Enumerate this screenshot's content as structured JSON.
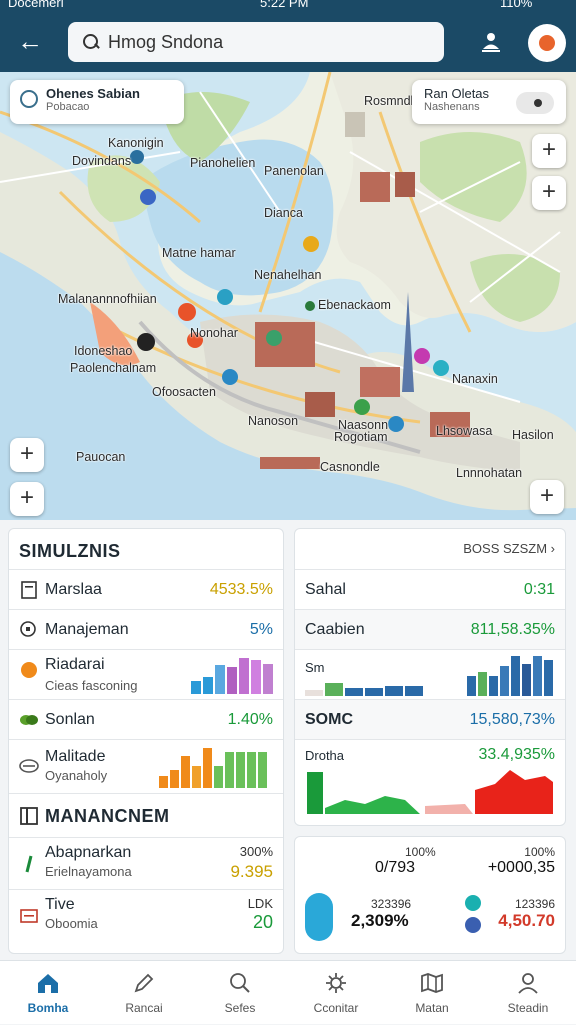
{
  "status_bar": {
    "carrier": "Docemeri",
    "time": "5:22 PM",
    "battery": "110%"
  },
  "search": {
    "value": "Hmog Sndona"
  },
  "map": {
    "left_card": {
      "title": "Ohenes Sabian",
      "subtitle": "Pobacao"
    },
    "right_card": {
      "title": "Ran Oletas",
      "subtitle": "Nashenans"
    },
    "labels": [
      "Rosmndle",
      "Kanonigin",
      "Dovindans",
      "Pianohelien",
      "Panenolan",
      "Dianca",
      "Matne hamar",
      "Nenahelhan",
      "Malanannnofhiian",
      "Ebenackaom",
      "Idoneshao",
      "Paolenchalnam",
      "Ofoosacten",
      "Nanaxin",
      "Naasonn",
      "Rogotiam",
      "Nanoson",
      "Casnondle",
      "Lnnnohatan",
      "Pauocan",
      "Hasilon",
      "Lhsowasa",
      "Nonohar"
    ]
  },
  "left_panel": {
    "header": "SIMULZNIS",
    "rows": [
      {
        "label": "Marslaa",
        "value": "4533.5%",
        "color": "#c9a000"
      },
      {
        "label": "Manajeman",
        "value": "5%",
        "color": "#1b6ea8"
      },
      {
        "label": "Riadarai",
        "sub": "Cieas fasconing"
      },
      {
        "label": "Sonlan",
        "value": "1.40%",
        "color": "#1a9a3a"
      },
      {
        "label": "Malitade",
        "sub": "Oyanaholy"
      }
    ],
    "section": "MANANCNEM",
    "rows2": [
      {
        "label": "Abapnarkan",
        "sub": "Erielnayamona",
        "value_top": "300%",
        "value": "9.395",
        "color": "#c9a000"
      },
      {
        "label": "Tive",
        "sub": "Oboomia",
        "value_top": "LDK",
        "value": "20",
        "color": "#1a9a3a"
      }
    ]
  },
  "right_panel": {
    "header": "BOSS SZSZM",
    "rows": [
      {
        "label": "Sahal",
        "value": "0:31",
        "color": "#1a9a3a"
      },
      {
        "label": "Caabien",
        "value": "811,58.35%",
        "color": "#1a9a3a"
      },
      {
        "label": "Sm"
      },
      {
        "label": "SOMC",
        "value": "15,580,73%",
        "color": "#1b6ea8"
      },
      {
        "label": "Drotha",
        "value": "33.4,935%",
        "color": "#1a9a3a"
      }
    ],
    "stats": [
      {
        "top": "100%",
        "value": "0/793"
      },
      {
        "top": "100%",
        "value": "+0000,35"
      },
      {
        "top": "323396",
        "value": "2,309%"
      },
      {
        "top": "123396",
        "value": "4,50.70",
        "color": "#d23a2a"
      }
    ]
  },
  "charts": {
    "riadarai": [
      0.35,
      0.45,
      0.75,
      0.7,
      0.95,
      0.9,
      0.8
    ],
    "malitade": [
      0.3,
      0.45,
      0.8,
      0.55,
      1.0,
      0.55,
      0.9,
      0.9,
      0.9,
      0.9
    ],
    "sm_left": [
      0.15,
      0.35,
      0.2,
      0.2,
      0.25,
      0.25
    ],
    "sm_right": [
      0.5,
      0.6,
      0.5,
      0.75,
      1.0,
      0.8,
      1.0,
      0.9
    ],
    "drotha_colors": [
      "#1a9a3a",
      "#2db34a",
      "#e8231a"
    ]
  },
  "nav": [
    {
      "label": "Bomha",
      "icon": "home-icon",
      "active": true
    },
    {
      "label": "Rancai",
      "icon": "pen-icon"
    },
    {
      "label": "Sefes",
      "icon": "search-icon"
    },
    {
      "label": "Cconitar",
      "icon": "gear-icon"
    },
    {
      "label": "Matan",
      "icon": "map-icon"
    },
    {
      "label": "Steadin",
      "icon": "user-icon"
    }
  ]
}
